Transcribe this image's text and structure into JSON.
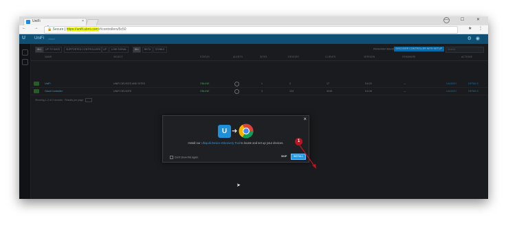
{
  "browser": {
    "tab_title": "UniFi",
    "tab_close": "×",
    "window_controls": "— ☐ ✕",
    "nav_icons": "← → C",
    "secure_label": "Secure",
    "url_highlight": "https://unifi.ubnt.com",
    "url_path": "/#/controllers/5c50",
    "tool_icons": "★ ⋮"
  },
  "app": {
    "logo": "U",
    "name": "UniFi",
    "subtitle": "cloud"
  },
  "toolbar": {
    "buttons": [
      "ALL",
      "UP TO DATE",
      "SUPPORTED CONTROLLERS",
      "UP",
      "LOW SIGNAL",
      "ALL",
      "BETA",
      "STABLE"
    ],
    "remember_label": "Remember Selection",
    "remember_value": "OFF",
    "discover_button": "DISCOVER CONTROLLER WITH SETUP",
    "search_placeholder": "Search"
  },
  "table": {
    "headers": [
      "NAME",
      "SELECT",
      "STATUS",
      "ALERTS",
      "SITES",
      "DEVICES",
      "CLIENTS",
      "VERSION",
      "FIRMWARE",
      "ACTIONS"
    ],
    "rows": [
      {
        "name": "UniFi",
        "select": "UNIFI DEVICES AND SITES",
        "status": "ONLINE",
        "sites": "1",
        "devices": "2",
        "clients": "17",
        "version": "5.6.22",
        "firmware": "—",
        "act1": "LAUNCH",
        "act2": "DETAILS"
      },
      {
        "name": "Cloud Controller",
        "select": "UNIFI DEVICES",
        "status": "ONLINE",
        "sites": "3",
        "devices": "124",
        "clients": "3245",
        "version": "5.6.26",
        "firmware": "—",
        "act1": "LAUNCH",
        "act2": "DETAILS"
      }
    ],
    "footer": "Showing 1-2 of 2 records",
    "results_per_page": "Results per page",
    "page_size": "10"
  },
  "modal": {
    "close": "×",
    "ulogo": "U",
    "arrow": "➜",
    "text_before": "Install our ",
    "link_text": "Ubiquiti Device Discovery Tool",
    "text_after": " to locate and set up your devices.",
    "dont_show": "Don't show this again.",
    "skip_label": "SKIP",
    "install_label": "INSTALL",
    "badge": "1"
  },
  "colors": {
    "accent": "#1d9be6",
    "badge": "#c0121e",
    "header": "#0f4f74"
  }
}
